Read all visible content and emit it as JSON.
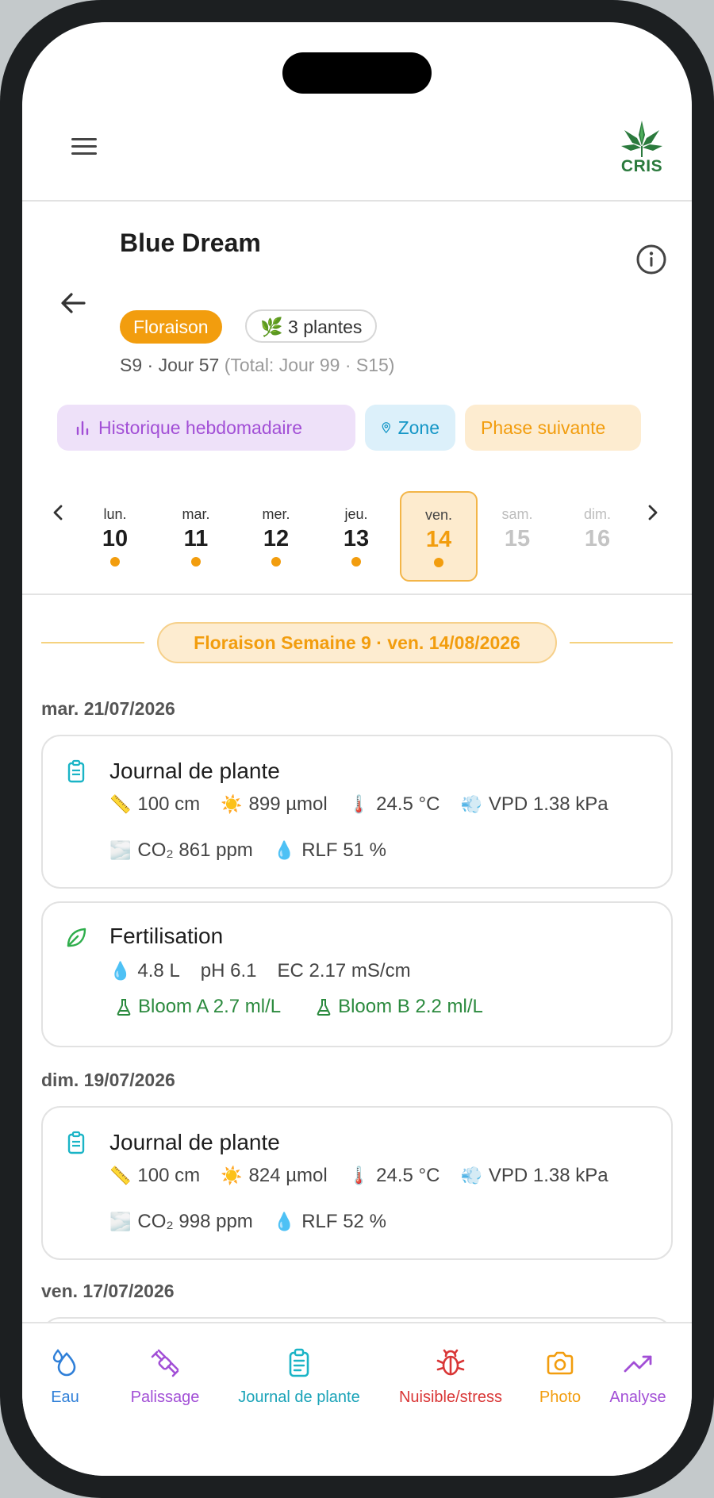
{
  "app": {
    "logo_text": "CRIS"
  },
  "plant": {
    "name": "Blue Dream",
    "phase": "Floraison",
    "plants_count": "3 plantes",
    "plants_icon": "🌿",
    "week_day": "S9 · Jour 57",
    "total": "(Total: Jour 99 · S15)"
  },
  "actions": {
    "history": "Historique hebdomadaire",
    "zone": "Zone",
    "next_phase": "Phase suivante"
  },
  "days": [
    {
      "name": "lun.",
      "num": "10"
    },
    {
      "name": "mar.",
      "num": "11"
    },
    {
      "name": "mer.",
      "num": "12"
    },
    {
      "name": "jeu.",
      "num": "13"
    },
    {
      "name": "ven.",
      "num": "14"
    },
    {
      "name": "sam.",
      "num": "15"
    },
    {
      "name": "dim.",
      "num": "16"
    }
  ],
  "week_banner": "Floraison Semaine 9 · ven. 14/08/2026",
  "entries": {
    "date1": "mar. 21/07/2026",
    "journal1": {
      "title": "Journal de plante",
      "height": "100 cm",
      "light": "899 µmol",
      "temp": "24.5 °C",
      "vpd": "VPD 1.38 kPa",
      "co2": "CO₂ 861 ppm",
      "rh": "RLF 51 %"
    },
    "fert1": {
      "title": "Fertilisation",
      "volume": "4.8 L",
      "ph": "pH 6.1",
      "ec": "EC 2.17 mS/cm",
      "add1": "Bloom A 2.7 ml/L",
      "add2": "Bloom B 2.2 ml/L"
    },
    "date2": "dim. 19/07/2026",
    "journal2": {
      "title": "Journal de plante",
      "height": "100 cm",
      "light": "824 µmol",
      "temp": "24.5 °C",
      "vpd": "VPD 1.38 kPa",
      "co2": "CO₂ 998 ppm",
      "rh": "RLF 52 %"
    },
    "date3": "ven. 17/07/2026"
  },
  "emoji": {
    "ruler": "📏",
    "sun": "☀️",
    "thermo": "🌡️",
    "wind": "💨",
    "fog": "🌫️",
    "drop": "💧"
  },
  "bottom_nav": {
    "eau": "Eau",
    "palissage": "Palissage",
    "journal": "Journal de plante",
    "nuisible": "Nuisible/stress",
    "photo": "Photo",
    "analyse": "Analyse"
  },
  "colors": {
    "accent_orange": "#f29d0e",
    "purple": "#a24fd6",
    "cyan": "#1496c6",
    "green": "#2b8a3e",
    "red": "#d93636"
  }
}
